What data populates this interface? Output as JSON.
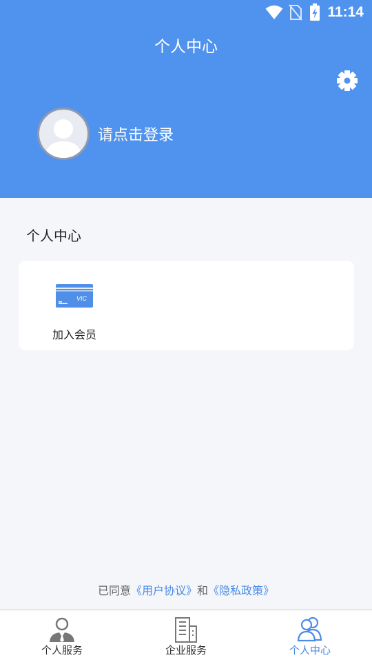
{
  "status_bar": {
    "time": "11:14",
    "icons": [
      "wifi-icon",
      "no-sim-icon",
      "battery-charging-icon"
    ]
  },
  "header": {
    "title": "个人中心",
    "settings_icon": "gear-icon",
    "login_prompt": "请点击登录",
    "avatar_icon": "default-avatar-icon"
  },
  "section": {
    "title": "个人中心",
    "items": [
      {
        "label": "加入会员",
        "icon": "vip-card-icon",
        "icon_text": "VIC"
      }
    ]
  },
  "agreement": {
    "prefix": "已同意",
    "user_agreement": "《用户协议》",
    "conjunction": "和",
    "privacy_policy": "《隐私政策》"
  },
  "tabs": [
    {
      "label": "个人服务",
      "icon": "person-tie-icon",
      "active": false
    },
    {
      "label": "企业服务",
      "icon": "building-icon",
      "active": false
    },
    {
      "label": "个人中心",
      "icon": "users-icon",
      "active": true
    }
  ],
  "colors": {
    "header_bg": "#5093ee",
    "accent": "#4a8be6",
    "page_bg": "#f4f6fa",
    "inactive_icon": "#777777"
  }
}
